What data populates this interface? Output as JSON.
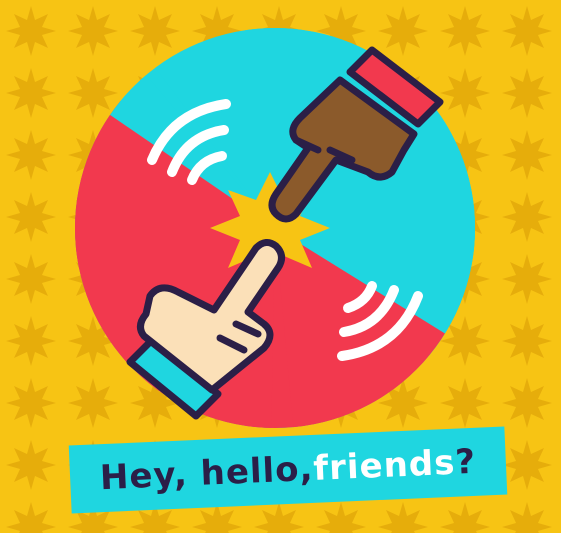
{
  "banner": {
    "part1": "Hey, hello, ",
    "part2": "friends",
    "part3": "?"
  },
  "colors": {
    "background": "#f7c414",
    "star_pattern": "#e6ad0b",
    "circle_cyan": "#1fd6e0",
    "circle_red": "#f2394e",
    "burst": "#f7c414",
    "outline": "#2b1f47",
    "hand_dark": "#8b5a2b",
    "hand_light": "#fbe0b8",
    "waves": "#ffffff"
  },
  "icons": [
    "star-pattern",
    "touching-hands-icon",
    "impact-burst-icon",
    "sound-wave-icon"
  ]
}
